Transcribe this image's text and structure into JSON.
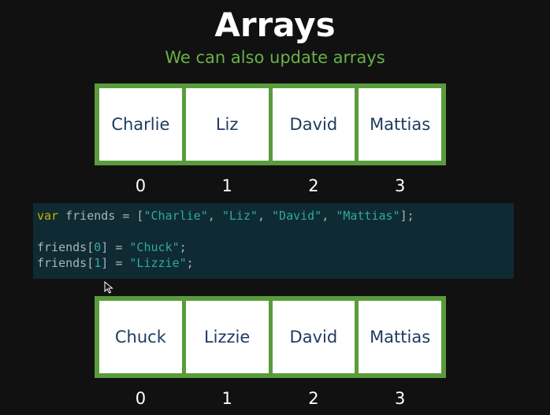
{
  "slide": {
    "title": "Arrays",
    "subtitle": "We can also update arrays"
  },
  "colors": {
    "background": "#111111",
    "accent_green": "#5a9b3c",
    "subtitle_green": "#69b148",
    "cell_text": "#1e3a5f",
    "code_background": "#0f2a33",
    "code_keyword": "#c8b400",
    "code_string": "#2fa9a0"
  },
  "array_before": {
    "cells": [
      "Charlie",
      "Liz",
      "David",
      "Mattias"
    ],
    "indices": [
      "0",
      "1",
      "2",
      "3"
    ]
  },
  "code": {
    "line1": {
      "keyword": "var",
      "ident": " friends = [",
      "s1": "\"Charlie\"",
      "sep1": ", ",
      "s2": "\"Liz\"",
      "sep2": ", ",
      "s3": "\"David\"",
      "sep3": ", ",
      "s4": "\"Mattias\"",
      "end": "];"
    },
    "line2": {
      "lhs": "friends[",
      "index": "0",
      "mid": "] = ",
      "value": "\"Chuck\"",
      "end": ";"
    },
    "line3": {
      "lhs": "friends[",
      "index": "1",
      "mid": "] = ",
      "value": "\"Lizzie\"",
      "end": ";"
    }
  },
  "array_after": {
    "cells": [
      "Chuck",
      "Lizzie",
      "David",
      "Mattias"
    ],
    "indices": [
      "0",
      "1",
      "2",
      "3"
    ]
  },
  "cursor": {
    "icon": "arrow-cursor-icon"
  }
}
